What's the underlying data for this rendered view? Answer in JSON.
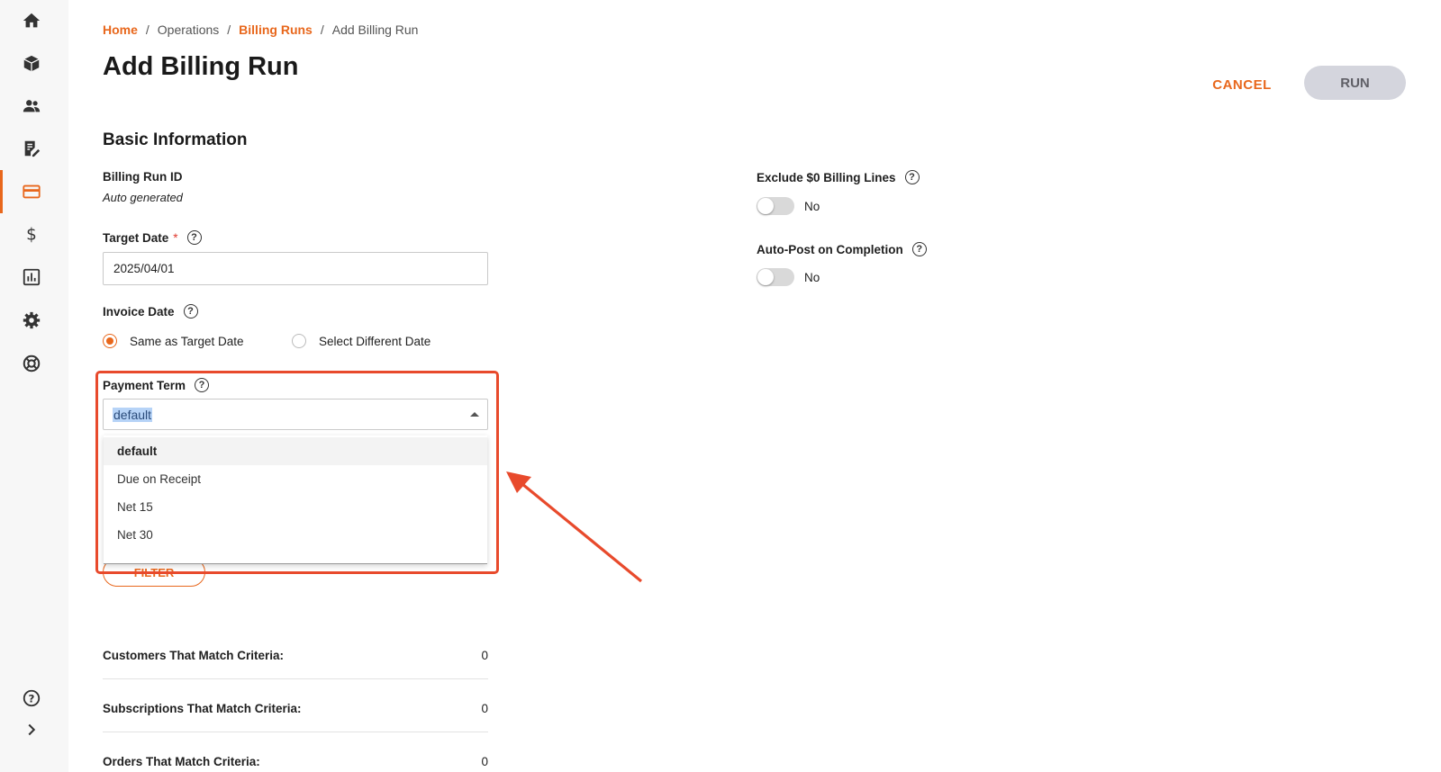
{
  "sidebar": {
    "items": [
      {
        "icon": "home-icon"
      },
      {
        "icon": "cube-icon"
      },
      {
        "icon": "users-icon"
      },
      {
        "icon": "document-edit-icon"
      },
      {
        "icon": "credit-card-icon",
        "active": true
      },
      {
        "icon": "dollar-icon"
      },
      {
        "icon": "bar-chart-icon"
      },
      {
        "icon": "gear-icon"
      },
      {
        "icon": "lifebuoy-icon"
      }
    ],
    "bottom": [
      {
        "icon": "help-icon"
      },
      {
        "icon": "chevron-right-icon"
      }
    ]
  },
  "breadcrumb": {
    "home": "Home",
    "operations": "Operations",
    "billing_runs": "Billing Runs",
    "current": "Add Billing Run",
    "separator": "/"
  },
  "page": {
    "title": "Add Billing Run"
  },
  "actions": {
    "cancel": "CANCEL",
    "run": "RUN"
  },
  "basic_info": {
    "section_title": "Basic Information",
    "billing_run_id_label": "Billing Run ID",
    "billing_run_id_value": "Auto generated",
    "target_date_label": "Target Date",
    "target_date_required": "*",
    "target_date_value": "2025/04/01",
    "invoice_date_label": "Invoice Date",
    "invoice_date_options": [
      "Same as Target Date",
      "Select Different Date"
    ],
    "invoice_date_selected": "Same as Target Date",
    "payment_term_label": "Payment Term",
    "payment_term_value": "default",
    "payment_term_options": [
      "default",
      "Due on Receipt",
      "Net 15",
      "Net 30"
    ],
    "filter_button": "FILTER"
  },
  "toggles": {
    "exclude_zero_label": "Exclude $0 Billing Lines",
    "exclude_zero_value": "No",
    "auto_post_label": "Auto-Post on Completion",
    "auto_post_value": "No"
  },
  "stats": [
    {
      "label": "Customers That Match Criteria:",
      "value": "0"
    },
    {
      "label": "Subscriptions That Match Criteria:",
      "value": "0"
    },
    {
      "label": "Orders That Match Criteria:",
      "value": "0"
    }
  ],
  "colors": {
    "accent": "#e8671c",
    "annotation": "#e84a2c",
    "run_disabled": "#d4d5dd"
  }
}
